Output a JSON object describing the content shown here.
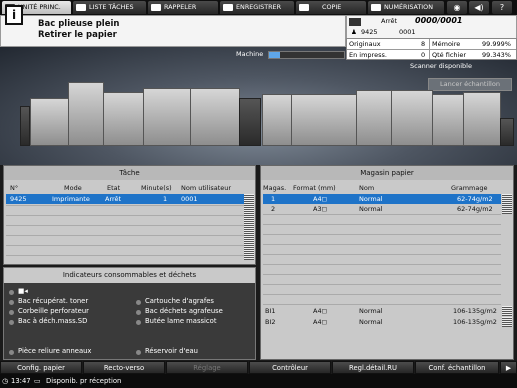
{
  "tabs": [
    {
      "label": "UNITÉ PRINC.",
      "active": true
    },
    {
      "label": "LISTE TÂCHES"
    },
    {
      "label": "RAPPELER"
    },
    {
      "label": "ENREGISTRER"
    },
    {
      "label": "COPIE"
    },
    {
      "label": "NUMÉRISATION"
    }
  ],
  "icons": {
    "globe": "◉",
    "volume": "◀)",
    "help": "?"
  },
  "message": {
    "line1": "Bac plieuse plein",
    "line2": "Retirer le papier"
  },
  "status": {
    "arrow": "Arrêt",
    "counter": "0000/0001",
    "user_icon": "♟",
    "user_id": "9425",
    "user_count": "0001",
    "originaux_label": "Originaux",
    "originaux_value": "8",
    "memoire_label": "Mémoire",
    "memoire_value": "99.999%",
    "en_impress_label": "En impress.",
    "en_impress_value": "0",
    "qte_fichier_label": "Qté fichier",
    "qte_fichier_value": "99.343%"
  },
  "machine": {
    "label": "Machine",
    "progress": 0.15,
    "scanner": "Scanner disponible",
    "sample_button": "Lancer échantillon"
  },
  "tache": {
    "title": "Tâche",
    "columns": [
      "N°",
      "Mode",
      "Etat",
      "Minute(s)",
      "Nom utilisateur"
    ],
    "rows": [
      {
        "n": "9425",
        "mode": "Imprimante",
        "etat": "Arrêt",
        "minutes": "1",
        "user": "0001"
      }
    ]
  },
  "magasin": {
    "title": "Magasin papier",
    "columns": [
      "Magas.",
      "Format (mm)",
      "Nom",
      "Grammage"
    ],
    "rows": [
      {
        "tray": "1",
        "format": "A4◻",
        "name": "Normal",
        "gram": "62-74g/m2"
      },
      {
        "tray": "2",
        "format": "A3◻",
        "name": "Normal",
        "gram": "62-74g/m2"
      },
      {
        "tray": "BI1",
        "format": "A4◻",
        "name": "Normal",
        "gram": "106-135g/m2"
      },
      {
        "tray": "BI2",
        "format": "A4◻",
        "name": "Normal",
        "gram": "106-135g/m2"
      }
    ]
  },
  "consumables": {
    "title": "Indicateurs consommables et déchets",
    "left": [
      "Bac récupérat. toner",
      "Corbeille perforateur",
      "Bac à déch.mass.SD"
    ],
    "right": [
      "Cartouche d'agrafes",
      "Bac déchets agrafeuse",
      "Butée lame massicot"
    ],
    "bottom_left": "Pièce reliure anneaux",
    "bottom_right": "Réservoir d'eau"
  },
  "toolbar": [
    "Config. papier",
    "Recto-verso",
    "Réglage",
    "Contrôleur",
    "Regl.détail.RU",
    "Conf. échantillon"
  ],
  "statusbar": {
    "time": "13:47",
    "text": "Disponib. pr réception"
  }
}
